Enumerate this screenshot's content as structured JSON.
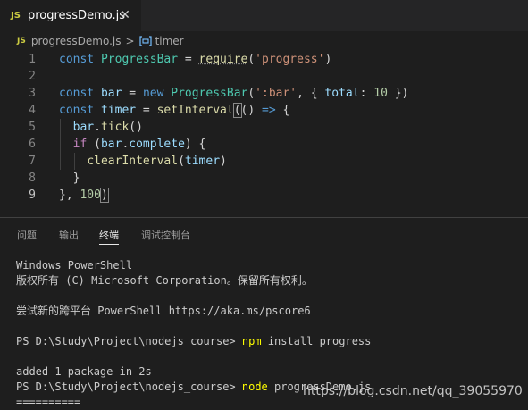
{
  "tab": {
    "badge": "JS",
    "title": "progressDemo.js",
    "close": "✕"
  },
  "breadcrumb": {
    "badge": "JS",
    "file": "progressDemo.js",
    "separator": ">",
    "symbol": "timer"
  },
  "editor": {
    "lines": [
      {
        "n": "1",
        "tokens": [
          {
            "t": "const ",
            "c": "k"
          },
          {
            "t": "ProgressBar",
            "c": "c"
          },
          {
            "t": " = ",
            "c": "p"
          },
          {
            "t": "require",
            "c": "f req"
          },
          {
            "t": "(",
            "c": "p"
          },
          {
            "t": "'progress'",
            "c": "s"
          },
          {
            "t": ")",
            "c": "p"
          }
        ]
      },
      {
        "n": "2",
        "tokens": []
      },
      {
        "n": "3",
        "tokens": [
          {
            "t": "const ",
            "c": "k"
          },
          {
            "t": "bar",
            "c": "v"
          },
          {
            "t": " = ",
            "c": "p"
          },
          {
            "t": "new ",
            "c": "k"
          },
          {
            "t": "ProgressBar",
            "c": "c"
          },
          {
            "t": "(",
            "c": "p"
          },
          {
            "t": "':bar'",
            "c": "s"
          },
          {
            "t": ", { ",
            "c": "p"
          },
          {
            "t": "total",
            "c": "v"
          },
          {
            "t": ": ",
            "c": "p"
          },
          {
            "t": "10",
            "c": "n"
          },
          {
            "t": " })",
            "c": "p"
          }
        ]
      },
      {
        "n": "4",
        "tokens": [
          {
            "t": "const ",
            "c": "k"
          },
          {
            "t": "timer",
            "c": "v"
          },
          {
            "t": " = ",
            "c": "p"
          },
          {
            "t": "setInterval",
            "c": "f"
          },
          {
            "t": "(",
            "c": "p brk"
          },
          {
            "t": "() ",
            "c": "p"
          },
          {
            "t": "=>",
            "c": "k"
          },
          {
            "t": " {",
            "c": "p"
          }
        ]
      },
      {
        "n": "5",
        "tokens": [
          {
            "t": "  ",
            "c": "p"
          },
          {
            "t": "bar",
            "c": "v"
          },
          {
            "t": ".",
            "c": "p"
          },
          {
            "t": "tick",
            "c": "f"
          },
          {
            "t": "()",
            "c": "p"
          }
        ]
      },
      {
        "n": "6",
        "tokens": [
          {
            "t": "  ",
            "c": "p"
          },
          {
            "t": "if",
            "c": "ctl"
          },
          {
            "t": " (",
            "c": "p"
          },
          {
            "t": "bar",
            "c": "v"
          },
          {
            "t": ".",
            "c": "p"
          },
          {
            "t": "complete",
            "c": "v"
          },
          {
            "t": ") {",
            "c": "p"
          }
        ]
      },
      {
        "n": "7",
        "tokens": [
          {
            "t": "    ",
            "c": "p"
          },
          {
            "t": "clearInterval",
            "c": "f"
          },
          {
            "t": "(",
            "c": "p"
          },
          {
            "t": "timer",
            "c": "v"
          },
          {
            "t": ")",
            "c": "p"
          }
        ]
      },
      {
        "n": "8",
        "tokens": [
          {
            "t": "  }",
            "c": "p"
          }
        ]
      },
      {
        "n": "9",
        "tokens": [
          {
            "t": "}, ",
            "c": "p"
          },
          {
            "t": "100",
            "c": "n"
          },
          {
            "t": ")",
            "c": "p brk"
          }
        ]
      }
    ]
  },
  "panel": {
    "tabs": [
      "问题",
      "输出",
      "终端",
      "调试控制台"
    ],
    "active_tab": "终端"
  },
  "terminal": {
    "lines": [
      {
        "text": "Windows PowerShell"
      },
      {
        "text": "版权所有 (C) Microsoft Corporation。保留所有权利。"
      },
      {
        "text": ""
      },
      {
        "text": "尝试新的跨平台 PowerShell https://aka.ms/pscore6"
      },
      {
        "text": ""
      },
      {
        "prompt": "PS D:\\Study\\Project\\nodejs_course> ",
        "cmd": "npm",
        "args": " install progress"
      },
      {
        "text": ""
      },
      {
        "text": "added 1 package in 2s"
      },
      {
        "prompt": "PS D:\\Study\\Project\\nodejs_course> ",
        "cmd": "node",
        "args": " progressDemo.js"
      },
      {
        "text": "=========="
      }
    ]
  },
  "watermark": "https://blog.csdn.net/qq_39055970",
  "colors": {
    "background": "#1e1e1e",
    "keyword": "#569cd6",
    "class": "#4ec9b0",
    "function": "#dcdcaa",
    "string": "#ce9178",
    "number": "#b5cea8",
    "variable": "#9cdcfe",
    "terminal_command": "#ffff00",
    "js_badge": "#cbcb41"
  }
}
